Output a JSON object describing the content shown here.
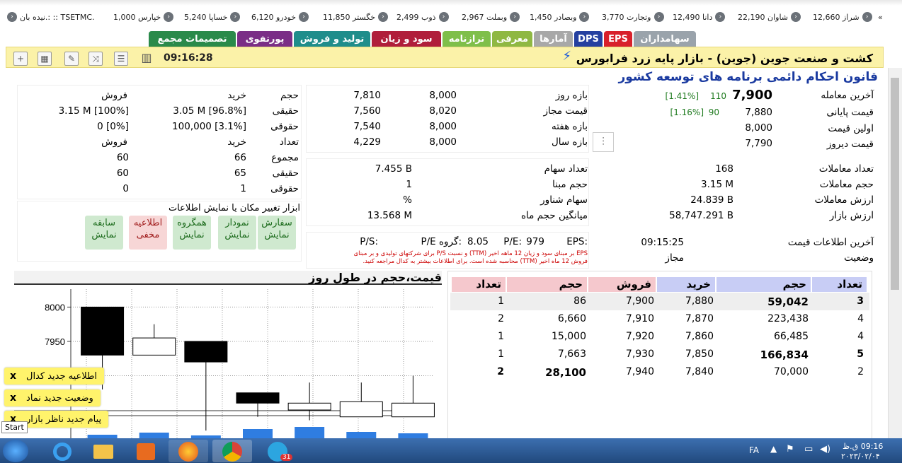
{
  "ticker": [
    {
      "label": "شراز 12,660"
    },
    {
      "label": "شاوان 22,190"
    },
    {
      "label": "دانا 12,490"
    },
    {
      "label": "وتجارت 3,770"
    },
    {
      "label": "وبصادر 1,450"
    },
    {
      "label": "وبملت 2,967"
    },
    {
      "label": "ذوب 2,499"
    },
    {
      "label": "خگستر 11,850"
    },
    {
      "label": "خودرو 6,120"
    },
    {
      "label": "خساپا 5,240"
    },
    {
      "label": "خپارس 1,000"
    },
    {
      "label": "نیده بان.: :: TSETMC."
    }
  ],
  "tabs": [
    {
      "label": "سهامداران",
      "color": "#9aa3ab"
    },
    {
      "label": "EPS",
      "color": "#d8202b"
    },
    {
      "label": "DPS",
      "color": "#2540a0"
    },
    {
      "label": "آمارها",
      "color": "#a8a8a8"
    },
    {
      "label": "معرفی",
      "color": "#8fb843"
    },
    {
      "label": "ترازنامه",
      "color": "#7fbf4a"
    },
    {
      "label": "سود و زیان",
      "color": "#b01e3b"
    },
    {
      "label": "تولید و فروش",
      "color": "#1f8d8b"
    },
    {
      "label": "پورتفوی",
      "color": "#7a2e86"
    },
    {
      "label": "تصمیمات مجمع",
      "color": "#2a8a4a"
    }
  ],
  "title": "کشت و صنعت جوین (جوین) - بازار پایه زرد فرابورس",
  "title_time": "09:16:28",
  "notice": "قانون احکام دائمی برنامه های توسعه کشور",
  "price": {
    "last_label": "آخرین معامله",
    "last_value": "7,900",
    "last_change": "110",
    "last_pct": "[1.41%]",
    "close_label": "قیمت پایانی",
    "close_value": "7,880",
    "close_change": "90",
    "close_pct": "[1.16%]",
    "first_label": "اولین قیمت",
    "first_value": "8,000",
    "yesterday_label": "قیمت دیروز",
    "yesterday_value": "7,790"
  },
  "ranges": {
    "day_label": "بازه روز",
    "day_low": "7,810",
    "day_high": "8,000",
    "allowed_label": "قیمت مجاز",
    "allowed_low": "7,560",
    "allowed_high": "8,020",
    "week_label": "بازه هفته",
    "week_low": "7,540",
    "week_high": "8,000",
    "year_label": "بازه سال",
    "year_low": "4,229",
    "year_high": "8,000"
  },
  "clients": {
    "h_volume": "حجم",
    "h_buy": "خرید",
    "h_sell": "فروش",
    "real_label": "حقیقی",
    "real_buy": "3.05 M [96.8%]",
    "real_sell": "3.15 M [100%]",
    "legal_label": "حقوقی",
    "legal_buy": "100,000 [3.1%]",
    "legal_sell": "0 [0%]",
    "h_count": "تعداد",
    "h_buy2": "خرید",
    "h_sell2": "فروش",
    "sum_label": "مجموع",
    "sum_buy": "66",
    "sum_sell": "60",
    "real2_label": "حقیقی",
    "real2_buy": "65",
    "real2_sell": "60",
    "legal2_label": "حقوقی",
    "legal2_buy": "1",
    "legal2_sell": "0"
  },
  "stats": {
    "trades_label": "تعداد معاملات",
    "trades": "168",
    "volume_label": "حجم معاملات",
    "volume": "3.15 M",
    "value_label": "ارزش معاملات",
    "value": "24.839 B",
    "mcap_label": "ارزش بازار",
    "mcap": "58,747.291 B",
    "shares_label": "تعداد سهام",
    "shares": "7.455 B",
    "base_label": "حجم مبنا",
    "base": "1",
    "float_label": "سهام شناور",
    "float": "%",
    "avgvol_label": "میانگین حجم ماه",
    "avgvol": "13.568 M"
  },
  "info": {
    "lastinfo_label": "آخرین اطلاعات قیمت",
    "lastinfo": "09:15:25",
    "status_label": "وضعیت",
    "status": "مجاز",
    "eps_label": "EPS:",
    "eps": "979",
    "pe_label": "P/E:",
    "pe": "8.05",
    "gpe_label": "P/E گروه:",
    "ps_label": "P/S:",
    "footnote1": "EPS بر مبنای سود و زیان 12 ماهه اخیر (TTM) و نسبت P/S برای شرکتهای تولیدی و بر مبنای",
    "footnote2": "فروش 12 ماه اخیر (TTM) محاسبه شده است. برای اطلاعات بیشتر به کدال مراجعه کنید."
  },
  "tools": {
    "title": "ابزار تغییر مکان یا نمایش اطلاعات",
    "buttons": [
      {
        "l1": "سفارش",
        "l2": "نمایش",
        "bg": "#cfe9cf",
        "fg": "#1c6b1c"
      },
      {
        "l1": "نمودار",
        "l2": "نمایش",
        "bg": "#cfe9cf",
        "fg": "#1c6b1c"
      },
      {
        "l1": "همگروه",
        "l2": "نمایش",
        "bg": "#cfe9cf",
        "fg": "#1c6b1c"
      },
      {
        "l1": "اطلاعیه",
        "l2": "مخفی",
        "bg": "#f7d6d6",
        "fg": "#a01c1c"
      },
      {
        "l1": "سابقه",
        "l2": "نمایش",
        "bg": "#cfe9cf",
        "fg": "#1c6b1c"
      }
    ]
  },
  "orderbook": {
    "h_count_buy": "تعداد",
    "h_vol_buy": "حجم",
    "h_price_buy": "خرید",
    "h_price_sell": "فروش",
    "h_vol_sell": "حجم",
    "h_count_sell": "تعداد",
    "rows": [
      {
        "cb": "3",
        "vb": "59,042",
        "pb": "7,880",
        "ps": "7,900",
        "vs": "86",
        "cs": "1",
        "bold_b": true,
        "bold_s": false
      },
      {
        "cb": "4",
        "vb": "223,438",
        "pb": "7,870",
        "ps": "7,910",
        "vs": "6,660",
        "cs": "2",
        "bold_b": false,
        "bold_s": false
      },
      {
        "cb": "4",
        "vb": "66,485",
        "pb": "7,860",
        "ps": "7,920",
        "vs": "15,000",
        "cs": "1",
        "bold_b": false,
        "bold_s": false
      },
      {
        "cb": "5",
        "vb": "166,834",
        "pb": "7,850",
        "ps": "7,930",
        "vs": "7,663",
        "cs": "1",
        "bold_b": true,
        "bold_s": false
      },
      {
        "cb": "2",
        "vb": "70,000",
        "pb": "7,840",
        "ps": "7,940",
        "vs": "28,100",
        "cs": "2",
        "bold_b": false,
        "bold_s": true
      }
    ]
  },
  "chart_title": "قیمت،حجم در طول روز",
  "chart_data": {
    "type": "candlestick",
    "y_ticks": [
      "8000",
      "7950",
      "7900"
    ],
    "ylim": [
      7850,
      8020
    ],
    "candles": [
      {
        "o": 7930,
        "c": 8000,
        "h": 8000,
        "l": 7880,
        "dir": "down"
      },
      {
        "o": 7955,
        "c": 7930,
        "h": 7975,
        "l": 7930,
        "dir": "up"
      },
      {
        "o": 7950,
        "c": 7920,
        "h": 7950,
        "l": 7820,
        "dir": "down"
      },
      {
        "o": 7875,
        "c": 7860,
        "h": 7875,
        "l": 7840,
        "dir": "down"
      },
      {
        "o": 7860,
        "c": 7850,
        "h": 7890,
        "l": 7835,
        "dir": "up"
      },
      {
        "o": 7840,
        "c": 7862,
        "h": 7890,
        "l": 7840,
        "dir": "up"
      },
      {
        "o": 7840,
        "c": 7860,
        "h": 7900,
        "l": 7840,
        "dir": "up"
      }
    ],
    "volumes": [
      0.4,
      0.55,
      0.35,
      0.8,
      0.95,
      0.6,
      0.5
    ]
  },
  "toasts": [
    {
      "label": "اطلاعیه جدید کدال"
    },
    {
      "label": "وضعیت جدید نماد"
    },
    {
      "label": "پیام جدید ناظر بازار"
    }
  ],
  "start_tooltip": "Start",
  "taskbar": {
    "lang": "FA",
    "time": "09:16 ق.ظ",
    "date": "۲۰۲۳/۰۲/۰۴",
    "badge": "31"
  },
  "colors": {
    "accent": "#1a3aa0",
    "title_bg": "#fbf2a8",
    "buy_head": "#c8cdf5",
    "sell_head": "#f5c8cd"
  }
}
